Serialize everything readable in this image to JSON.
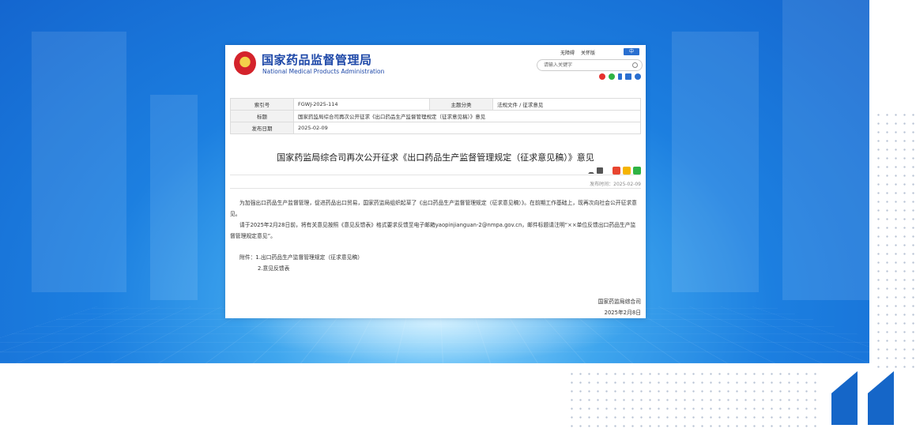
{
  "site": {
    "title": "国家药品监督管理局",
    "subtitle": "National Medical Products Administration",
    "top_links": [
      "无障碍",
      "关怀版"
    ],
    "lang_label": "中",
    "search_placeholder": "请输入关键字",
    "social_icons": [
      "weibo-icon",
      "wechat-icon",
      "mobile-icon",
      "email-icon",
      "user-icon"
    ]
  },
  "meta": {
    "index_label": "索引号",
    "index_value": "FGWJ-2025-114",
    "category_label": "主题分类",
    "category_value": "法规文件 / 征求意见",
    "title_label": "标题",
    "title_value": "国家药监局综合司再次公开征求《出口药品生产监督管理规定（征求意见稿）》意见",
    "date_label": "发布日期",
    "date_value": "2025-02-09"
  },
  "article": {
    "title": "国家药监局综合司再次公开征求《出口药品生产监督管理规定（征求意见稿）》意见",
    "publish_time": "发布时间：2025-02-09",
    "paragraph1": "为加强出口药品生产监督管理，促进药品出口贸易，国家药监局组织起草了《出口药品生产监督管理规定（征求意见稿）》。在前期工作基础上，现再次向社会公开征求意见。",
    "paragraph2": "请于2025年2月28日前，将有关意见按照《意见反馈表》格式要求反馈至电子邮箱yaopinjianguan-2@nmpa.gov.cn，邮件标题请注明“××单位反馈出口药品生产监督管理规定意见”。",
    "attachment1": "附件：1.出口药品生产监督管理规定（征求意见稿）",
    "attachment2": "2.意见反馈表",
    "signature_org": "国家药监局综合司",
    "signature_date": "2025年2月8日"
  },
  "colors": {
    "brand_blue": "#1e48a8",
    "banner_blue": "#1c7fe0",
    "quote_blue": "#1566c8"
  }
}
